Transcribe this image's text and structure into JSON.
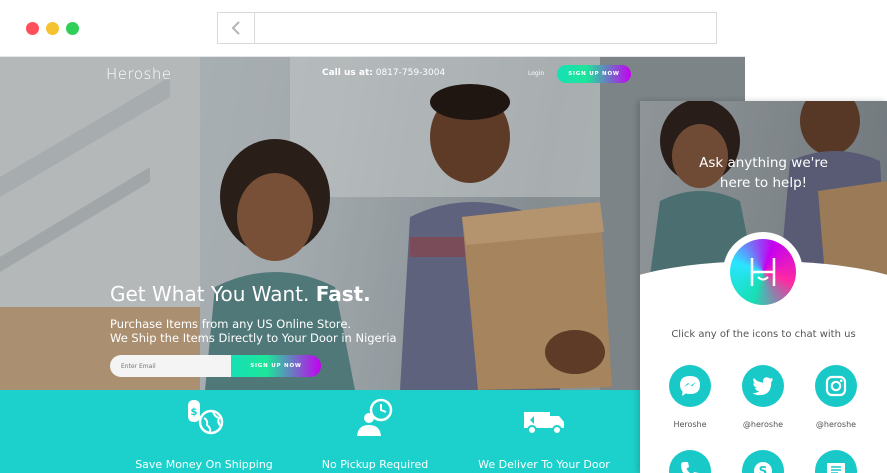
{
  "hero": {
    "brand": "Heroshe",
    "call_label": "Call us at:",
    "call_number": "0817-759-3004",
    "login": "Login",
    "signup": "SIGN UP NOW",
    "headline_main": "Get What You Want.",
    "headline_bold": "Fast.",
    "sub_line1": "Purchase Items from any US Online Store.",
    "sub_line2": "We Ship the Items Directly to Your Door in Nigeria",
    "email_placeholder": "Enter Email",
    "email_button": "SIGN UP NOW"
  },
  "features": [
    {
      "label": "Save Money On Shipping",
      "icon": "money-globe-icon"
    },
    {
      "label": "No Pickup Required",
      "icon": "clock-person-icon"
    },
    {
      "label": "We Deliver To Your Door",
      "icon": "delivery-truck-icon"
    }
  ],
  "widget": {
    "title_line1": "Ask anything we're",
    "title_line2": "here to help!",
    "prompt": "Click any of the icons to chat with us",
    "channels": [
      {
        "icon": "messenger-icon",
        "caption": "Heroshe"
      },
      {
        "icon": "twitter-icon",
        "caption": "@heroshe"
      },
      {
        "icon": "instagram-icon",
        "caption": "@heroshe"
      },
      {
        "icon": "phone-icon",
        "caption": ""
      },
      {
        "icon": "skype-icon",
        "caption": ""
      },
      {
        "icon": "message-icon",
        "caption": ""
      }
    ]
  },
  "colors": {
    "accent": "#1cd1cb",
    "gradient_start": "#16e0b5",
    "gradient_end": "#c400f0"
  }
}
